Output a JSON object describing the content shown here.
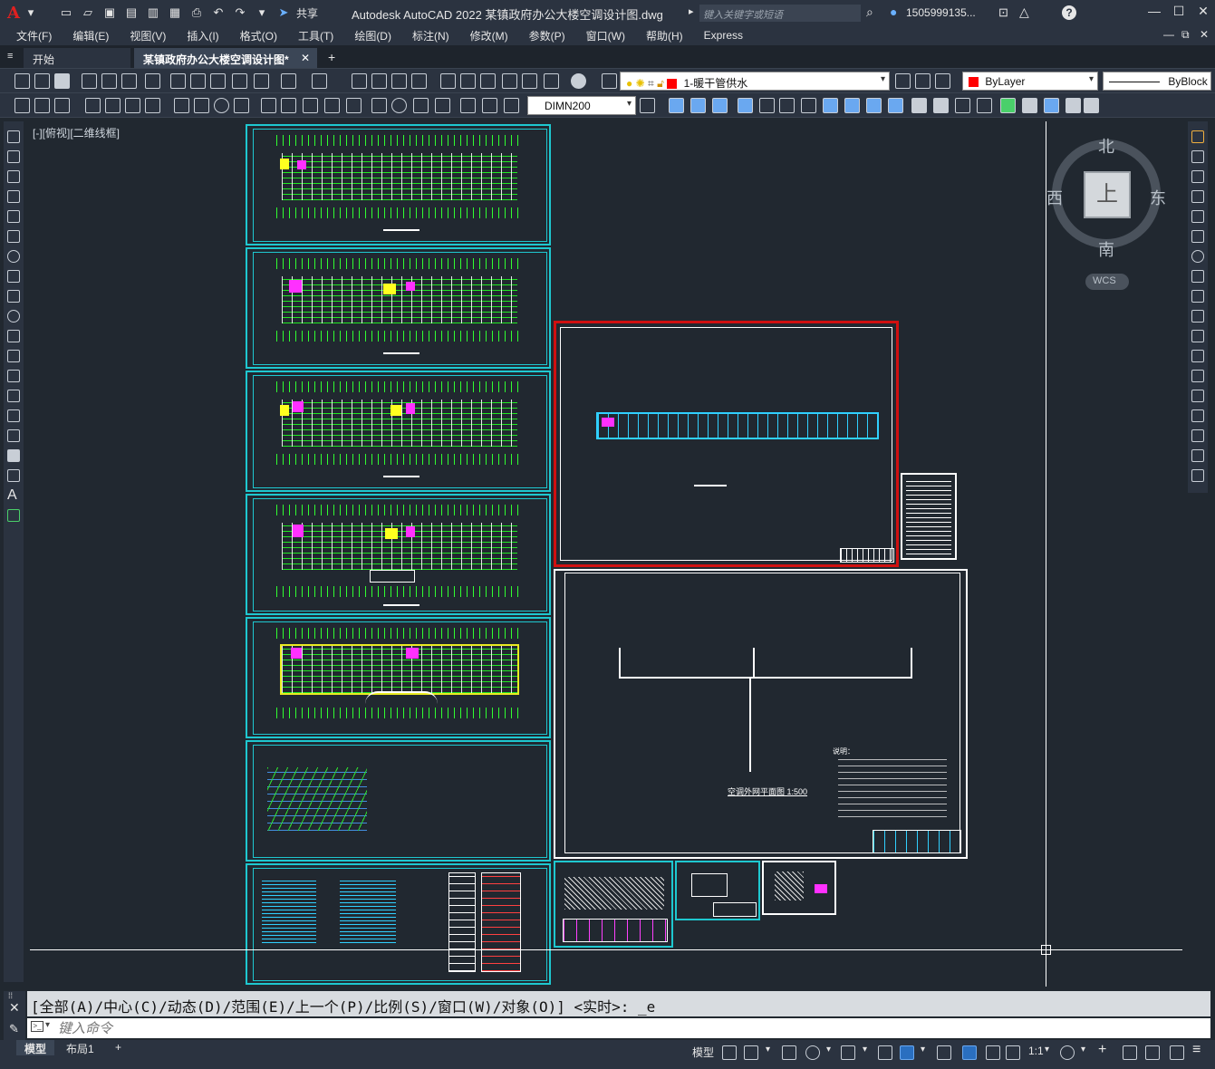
{
  "app": {
    "logo": "A",
    "title": "Autodesk AutoCAD 2022    某镇政府办公大楼空调设计图.dwg",
    "share_label": "共享",
    "search_placeholder": "键入关键字或短语",
    "user": "1505999135...",
    "window_controls": [
      "—",
      "☐",
      "✕"
    ]
  },
  "menu": {
    "items": [
      "文件(F)",
      "编辑(E)",
      "视图(V)",
      "插入(I)",
      "格式(O)",
      "工具(T)",
      "绘图(D)",
      "标注(N)",
      "修改(M)",
      "参数(P)",
      "窗口(W)",
      "帮助(H)",
      "Express"
    ]
  },
  "tabs": {
    "start": "开始",
    "file": "某镇政府办公大楼空调设计图*",
    "close": "✕",
    "add": "+"
  },
  "toolbar1": {
    "layer_name": "1-暖干管供水",
    "color_value": "ByLayer",
    "linetype_value": "ByBlock"
  },
  "toolbar2": {
    "dim_style": "DIMN200"
  },
  "canvas": {
    "viewport_label": "[-][俯视][二维线框]"
  },
  "viewcube": {
    "north": "北",
    "south": "南",
    "east": "东",
    "west": "西",
    "face": "上",
    "wcs": "WCS"
  },
  "drawing": {
    "elevation_title": "空调外网平面图  1:500",
    "notes_title": "说明："
  },
  "command": {
    "history": "[全部(A)/中心(C)/动态(D)/范围(E)/上一个(P)/比例(S)/窗口(W)/对象(O)] <实时>: _e",
    "placeholder": "键入命令"
  },
  "status": {
    "model_tab": "模型",
    "layout_tab": "布局1",
    "add_tab": "+",
    "model_label": "模型",
    "scale": "1:1"
  },
  "colors": {
    "sheet_border": "#1ec8d0",
    "selection_red": "#d01010",
    "accent_blue": "#2a6fc0"
  }
}
